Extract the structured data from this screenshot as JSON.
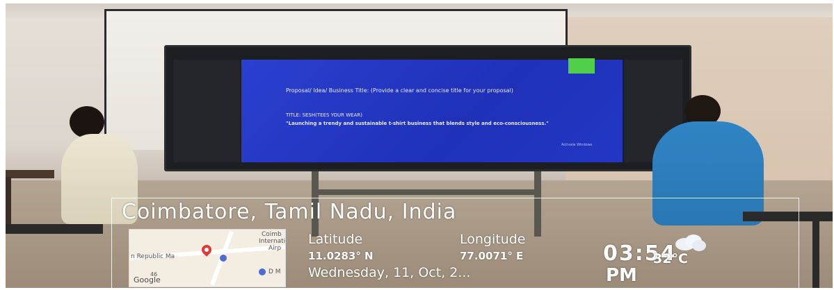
{
  "slide": {
    "bullet1": "Proposal/ Idea/ Business Title: (Provide a clear and concise title for your proposal)",
    "bullet2": "TITLE: SESH(TEES YOUR WEAR)",
    "bullet3": "\"Launching a trendy and sustainable t-shirt business that blends style and eco-consciousness.\"",
    "watermark": "Activate Windows"
  },
  "overlay": {
    "location": "Coimbatore, Tamil Nadu, India",
    "latitude_label": "Latitude",
    "latitude_value": "11.0283° N",
    "longitude_label": "Longitude",
    "longitude_value": "77.0071° E",
    "date": "Wednesday, 11, Oct, 2...",
    "time": "03:54",
    "ampm": "PM",
    "temperature": "32°C",
    "weather_icon": "cloud-icon",
    "map": {
      "label_republic": "n Republic Ma",
      "label_airport_a": "Coimb",
      "label_airport_b": "Internati",
      "label_airport_c": "Airp",
      "label_dmart": "D M",
      "label_google": "Google",
      "label_road": "46"
    }
  },
  "colors": {
    "screen_blue": "#2237c4",
    "green_box": "#4fcf4a",
    "overlay_text": "#ffffff"
  }
}
